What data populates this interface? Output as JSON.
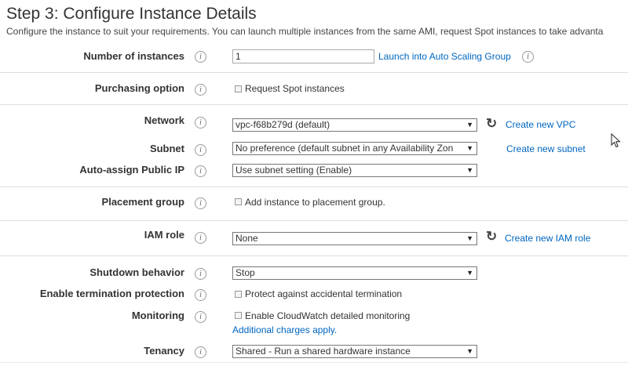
{
  "header": {
    "title": "Step 3: Configure Instance Details",
    "subtitle": "Configure the instance to suit your requirements. You can launch multiple instances from the same AMI, request Spot instances to take advanta"
  },
  "info_glyph": "i",
  "refresh_glyph": "↻",
  "dropdown_arrow": "▼",
  "number_of_instances": {
    "label": "Number of instances",
    "value": "1",
    "link": "Launch into Auto Scaling Group"
  },
  "purchasing_option": {
    "label": "Purchasing option",
    "checkbox_label": "Request Spot instances"
  },
  "network": {
    "label": "Network",
    "selected": "vpc-f68b279d (default)",
    "link": "Create new VPC"
  },
  "subnet": {
    "label": "Subnet",
    "selected": "No preference (default subnet in any Availability Zon",
    "link": "Create new subnet"
  },
  "auto_assign_ip": {
    "label": "Auto-assign Public IP",
    "selected": "Use subnet setting (Enable)"
  },
  "placement_group": {
    "label": "Placement group",
    "checkbox_label": "Add instance to placement group."
  },
  "iam_role": {
    "label": "IAM role",
    "selected": "None",
    "link": "Create new IAM role"
  },
  "shutdown_behavior": {
    "label": "Shutdown behavior",
    "selected": "Stop"
  },
  "termination_protection": {
    "label": "Enable termination protection",
    "checkbox_label": "Protect against accidental termination"
  },
  "monitoring": {
    "label": "Monitoring",
    "checkbox_label": "Enable CloudWatch detailed monitoring",
    "note": "Additional charges apply."
  },
  "tenancy": {
    "label": "Tenancy",
    "selected": "Shared - Run a shared hardware instance"
  }
}
